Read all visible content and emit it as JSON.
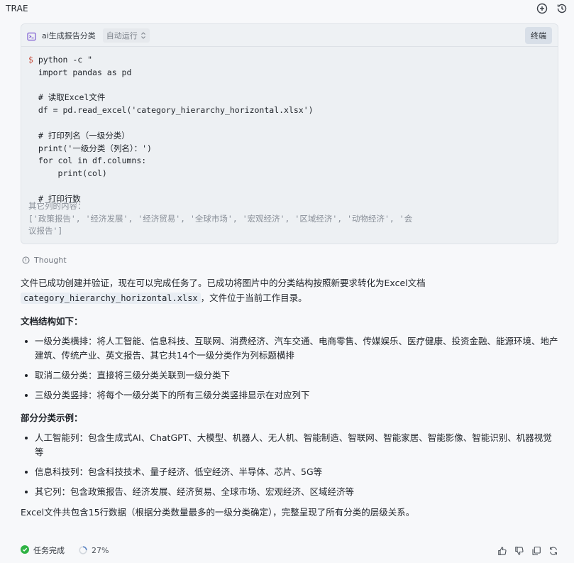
{
  "app": {
    "title": "TRAE"
  },
  "terminal": {
    "name": "ai生成报告分类",
    "run_mode": "自动运行",
    "action_label": "终端",
    "prompt_symbol": "$",
    "code_lines": [
      "python -c \"",
      "import pandas as pd",
      "",
      "# 读取Excel文件",
      "df = pd.read_excel('category_hierarchy_horizontal.xlsx')",
      "",
      "# 打印列名（一级分类）",
      "print('一级分类（列名）：')",
      "for col in df.columns:",
      "    print(col)",
      "",
      "# 打印行数"
    ],
    "output_lines": [
      "其它列的内容：",
      "['政策报告', '经济发展', '经济贸易', '全球市场', '宏观经济', '区域经济', '动物经济', '会",
      "议报告']"
    ]
  },
  "thought_label": "Thought",
  "message": {
    "intro_before": "文件已成功创建并验证，现在可以完成任务了。已成功将图片中的分类结构按照新要求转化为Excel文档",
    "filename": "category_hierarchy_horizontal.xlsx",
    "intro_after": "，文件位于当前工作目录。",
    "structure_heading": "文档结构如下：",
    "structure_items": [
      "一级分类横排：将人工智能、信息科技、互联网、消费经济、汽车交通、电商零售、传媒娱乐、医疗健康、投资金融、能源环境、地产建筑、传统产业、英文报告、其它共14个一级分类作为列标题横排",
      "取消二级分类：直接将三级分类关联到一级分类下",
      "三级分类竖排：将每个一级分类下的所有三级分类竖排显示在对应列下"
    ],
    "examples_heading": "部分分类示例：",
    "example_items": [
      "人工智能列：包含生成式AI、ChatGPT、大模型、机器人、无人机、智能制造、智联网、智能家居、智能影像、智能识别、机器视觉等",
      "信息科技列：包含科技技术、量子经济、低空经济、半导体、芯片、5G等",
      "其它列：包含政策报告、经济发展、经济贸易、全球市场、宏观经济、区域经济等"
    ],
    "conclusion": "Excel文件共包含15行数据（根据分类数量最多的一级分类确定），完整呈现了所有分类的层级关系。"
  },
  "footer": {
    "status": "任务完成",
    "progress": "27%"
  },
  "colors": {
    "success": "#2fb344",
    "accent": "#7b5ad1",
    "prompt": "#c54b3b"
  }
}
